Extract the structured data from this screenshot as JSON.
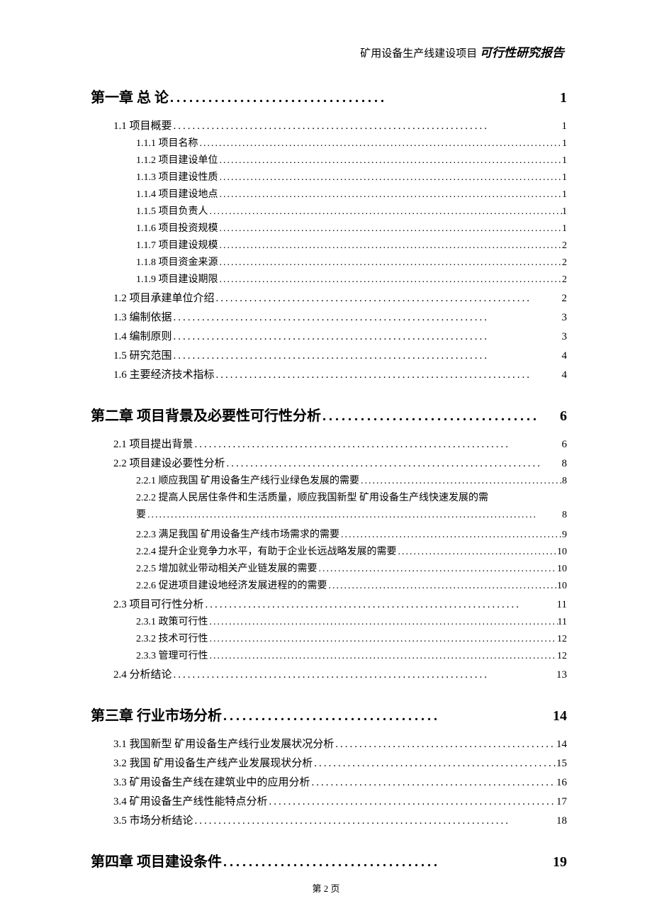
{
  "header": {
    "project": "矿用设备生产线建设项目",
    "title": "可行性研究报告"
  },
  "toc": [
    {
      "level": 1,
      "label": "第一章 总 论",
      "page": "1"
    },
    {
      "level": 2,
      "label": "1.1 项目概要",
      "page": "1"
    },
    {
      "level": 3,
      "label": "1.1.1 项目名称",
      "page": "1"
    },
    {
      "level": 3,
      "label": "1.1.2 项目建设单位",
      "page": "1"
    },
    {
      "level": 3,
      "label": "1.1.3 项目建设性质",
      "page": "1"
    },
    {
      "level": 3,
      "label": "1.1.4 项目建设地点",
      "page": "1"
    },
    {
      "level": 3,
      "label": "1.1.5 项目负责人",
      "page": "1"
    },
    {
      "level": 3,
      "label": "1.1.6 项目投资规模",
      "page": "1"
    },
    {
      "level": 3,
      "label": "1.1.7 项目建设规模",
      "page": "2"
    },
    {
      "level": 3,
      "label": "1.1.8 项目资金来源",
      "page": "2"
    },
    {
      "level": 3,
      "label": "1.1.9 项目建设期限",
      "page": "2"
    },
    {
      "level": 2,
      "label": "1.2 项目承建单位介绍",
      "page": "2"
    },
    {
      "level": 2,
      "label": "1.3 编制依据",
      "page": "3"
    },
    {
      "level": 2,
      "label": "1.4 编制原则",
      "page": "3"
    },
    {
      "level": 2,
      "label": "1.5 研究范围",
      "page": "4"
    },
    {
      "level": 2,
      "label": "1.6 主要经济技术指标",
      "page": "4"
    },
    {
      "level": 1,
      "label": "第二章 项目背景及必要性可行性分析",
      "page": "6"
    },
    {
      "level": 2,
      "label": "2.1 项目提出背景",
      "page": "6"
    },
    {
      "level": 2,
      "label": "2.2 项目建设必要性分析",
      "page": "8"
    },
    {
      "level": 3,
      "label": "2.2.1 顺应我国 矿用设备生产线行业绿色发展的需要",
      "page": "8"
    },
    {
      "level": 3,
      "wrap": true,
      "label1": "2.2.2 提高人民居住条件和生活质量，顺应我国新型 矿用设备生产线快速发展的需",
      "label2": "要",
      "page": "8"
    },
    {
      "level": 3,
      "label": "2.2.3 满足我国 矿用设备生产线市场需求的需要",
      "page": "9"
    },
    {
      "level": 3,
      "label": "2.2.4 提升企业竞争力水平，有助于企业长远战略发展的需要",
      "page": "10"
    },
    {
      "level": 3,
      "label": "2.2.5 增加就业带动相关产业链发展的需要",
      "page": "10"
    },
    {
      "level": 3,
      "label": "2.2.6 促进项目建设地经济发展进程的的需要",
      "page": "10"
    },
    {
      "level": 2,
      "label": "2.3 项目可行性分析",
      "page": "11"
    },
    {
      "level": 3,
      "label": "2.3.1 政策可行性",
      "page": "11"
    },
    {
      "level": 3,
      "label": "2.3.2 技术可行性",
      "page": "12"
    },
    {
      "level": 3,
      "label": "2.3.3 管理可行性",
      "page": "12"
    },
    {
      "level": 2,
      "label": "2.4 分析结论",
      "page": "13"
    },
    {
      "level": 1,
      "label": "第三章 行业市场分析",
      "page": "14"
    },
    {
      "level": 2,
      "label": "3.1 我国新型 矿用设备生产线行业发展状况分析",
      "page": "14"
    },
    {
      "level": 2,
      "label": "3.2 我国 矿用设备生产线产业发展现状分析",
      "page": "15"
    },
    {
      "level": 2,
      "label": "3.3 矿用设备生产线在建筑业中的应用分析",
      "page": "16"
    },
    {
      "level": 2,
      "label": "3.4 矿用设备生产线性能特点分析",
      "page": "17"
    },
    {
      "level": 2,
      "label": "3.5 市场分析结论",
      "page": "18"
    },
    {
      "level": 1,
      "label": "第四章 项目建设条件",
      "page": "19"
    }
  ],
  "footer": "第 2 页",
  "dots": {
    "h1": "..................................",
    "h2": "..................................................................",
    "h3": "...................................................................................................."
  }
}
